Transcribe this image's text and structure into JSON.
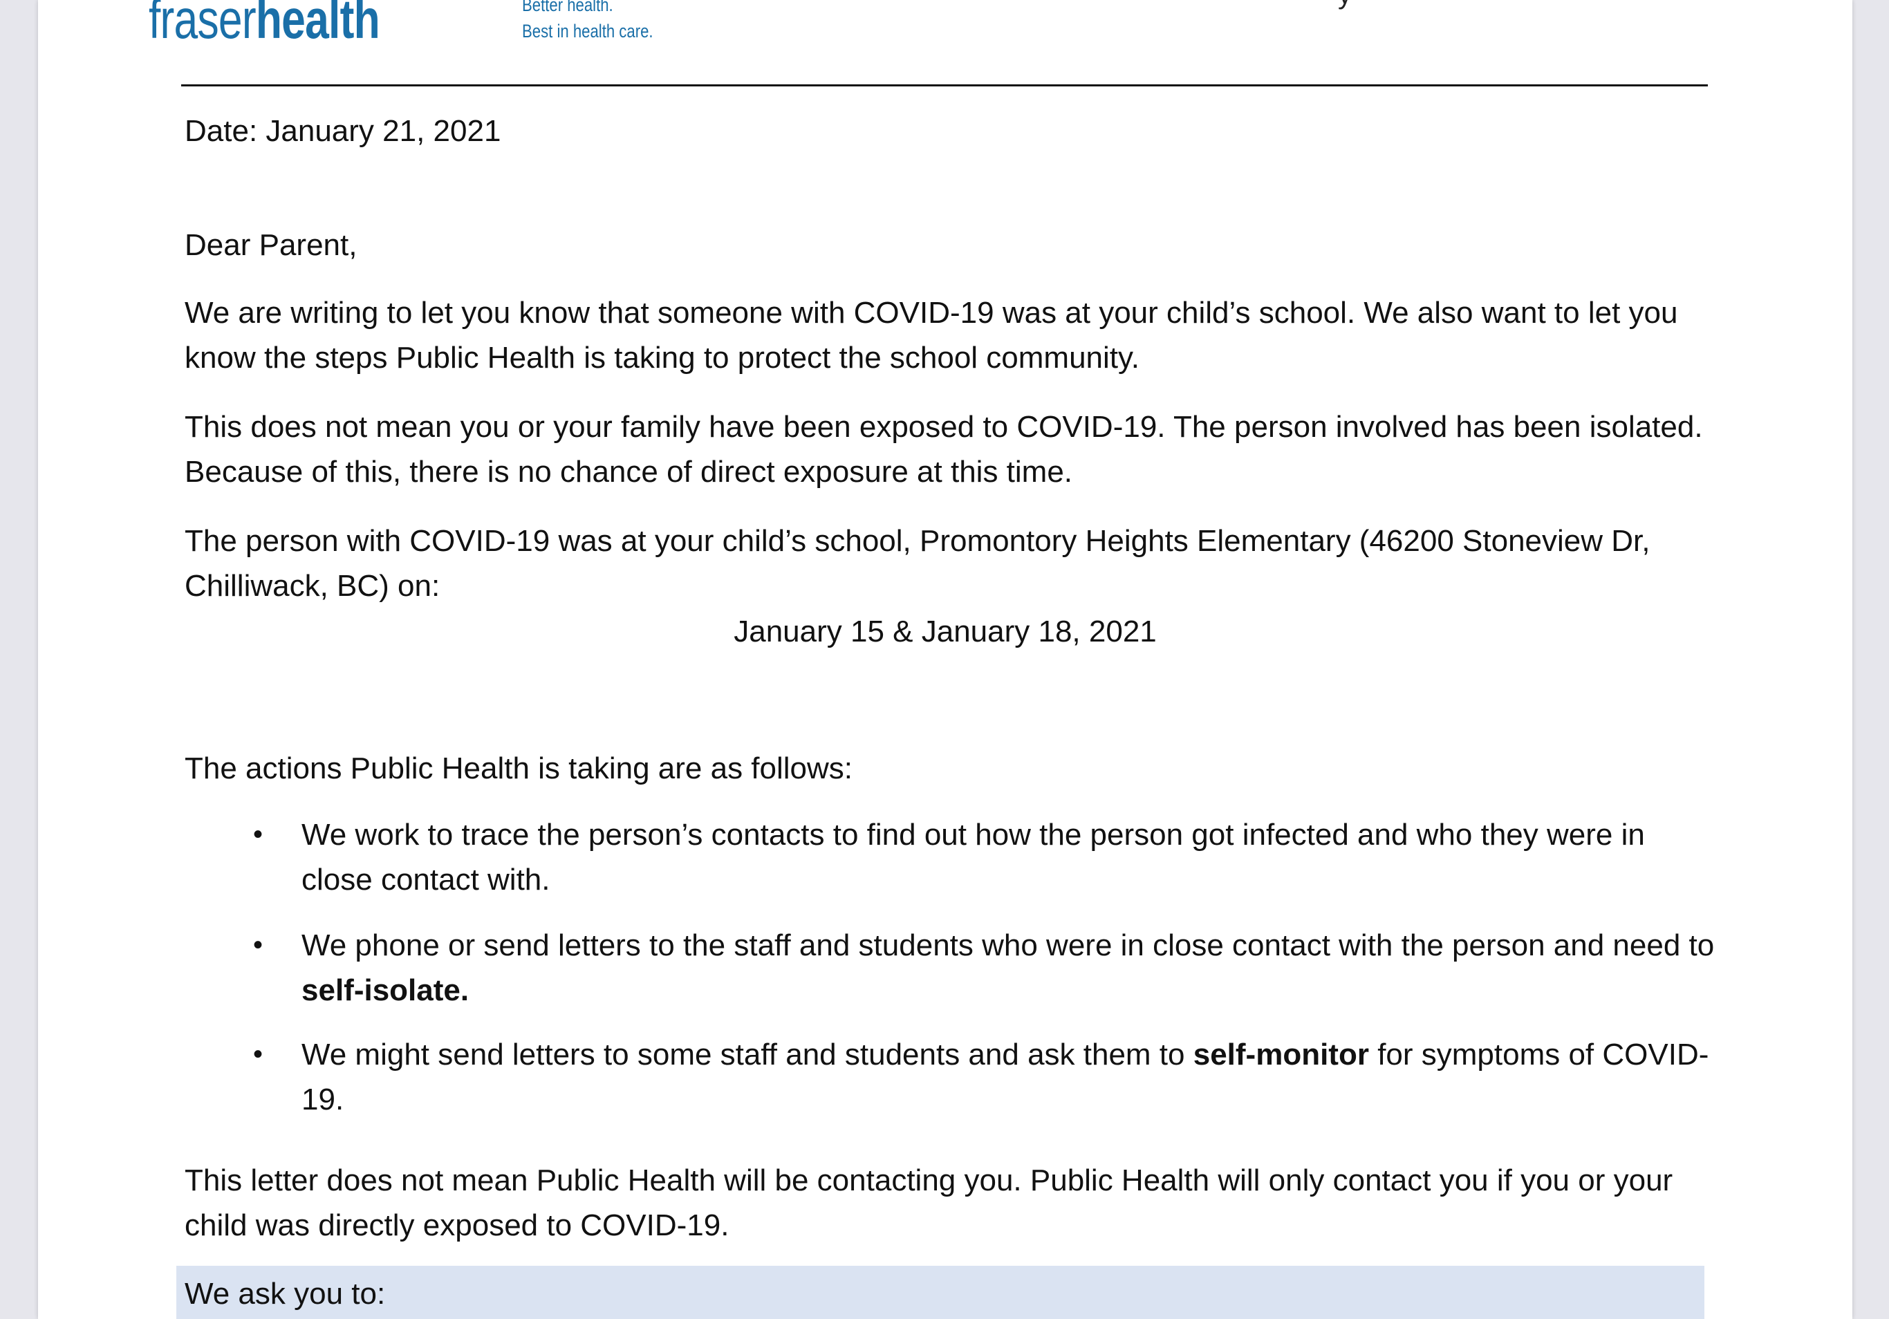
{
  "logo": {
    "brand_part1": "fraser",
    "brand_part2": "health",
    "tagline_line1": "Better health.",
    "tagline_line2": "Best in health care."
  },
  "header": {
    "fragment": "y"
  },
  "letter": {
    "date_line": "Date: January 21, 2021",
    "salutation": "Dear Parent,",
    "para1": "We are writing to let you know that someone with COVID-19 was at your child’s school. We also want to let you know the steps Public Health is taking to protect the school community.",
    "para2": "This does not mean you or your family have been exposed to COVID-19. The person involved has been isolated. Because of this, there is no chance of direct exposure at this time.",
    "para3": "The person with COVID-19 was at your child’s school, Promontory Heights Elementary (46200 Stoneview Dr, Chilliwack, BC) on:",
    "exposure_dates": "January 15 & January 18, 2021",
    "actions_intro": "The actions Public Health is taking are as follows:",
    "bullet_symbol": "•",
    "bullets": [
      {
        "text": "We work to trace the person’s contacts to find out how the person got infected and who they were in close contact with."
      },
      {
        "text_before": "We phone or send letters to the staff and students who were in close contact with the person and need to ",
        "bold": "self-isolate."
      },
      {
        "text_before": "We might send letters to some staff and students and ask them to ",
        "bold": "self-monitor",
        "text_after": " for symptoms of COVID-19."
      }
    ],
    "para4": "This letter does not mean Public Health will be contacting you. Public Health will only contact you if you or your child was directly exposed to COVID-19.",
    "callout_heading": "We ask you to:"
  }
}
